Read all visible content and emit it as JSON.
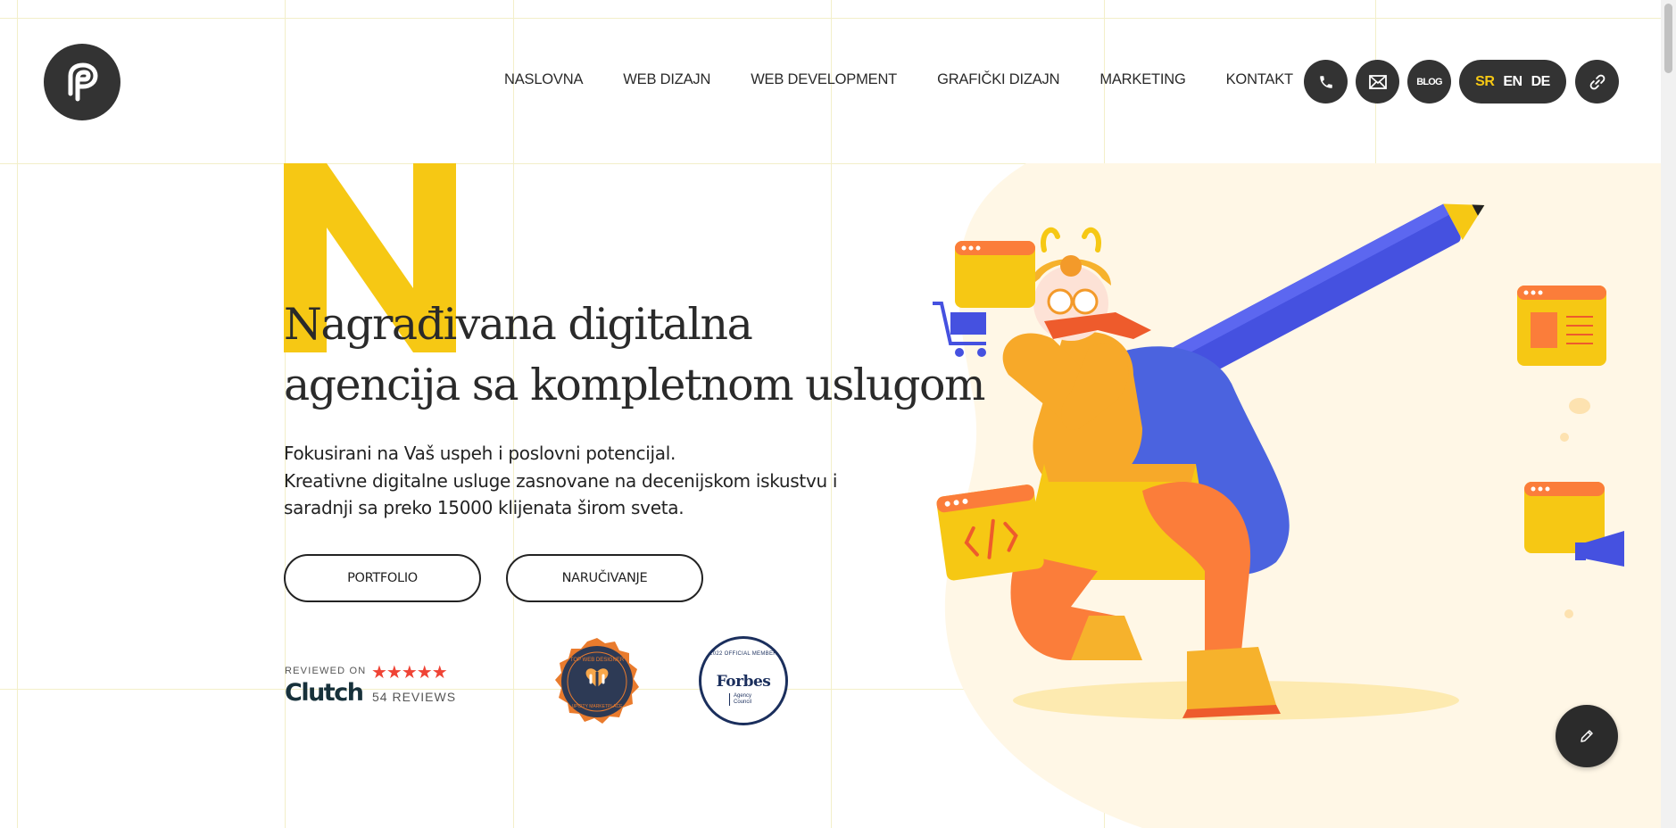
{
  "brand": {
    "logo_icon": "p-swirl-logo"
  },
  "nav": {
    "items": [
      {
        "label": "NASLOVNA"
      },
      {
        "label": "WEB DIZAJN"
      },
      {
        "label": "WEB DEVELOPMENT"
      },
      {
        "label": "GRAFIČKI DIZAJN"
      },
      {
        "label": "MARKETING"
      },
      {
        "label": "KONTAKT"
      }
    ]
  },
  "header_actions": {
    "phone_icon": "phone-icon",
    "mail_icon": "envelope-icon",
    "blog_label": "BLOG",
    "languages": [
      {
        "code": "SR",
        "active": true
      },
      {
        "code": "EN",
        "active": false
      },
      {
        "code": "DE",
        "active": false
      }
    ],
    "link_icon": "link-icon"
  },
  "hero": {
    "decor_letter": "N",
    "headline_line1": "Nagrađivana digitalna",
    "headline_line2": "agencija sa kompletnom uslugom",
    "sub_line1": "Fokusirani na Vaš uspeh i poslovni potencijal.",
    "sub_line2": "Kreativne digitalne usluge zasnovane na decenijskom iskustvu i",
    "sub_line3": "saradnji sa preko 15000 klijenata širom sveta.",
    "btn_portfolio": "PORTFOLIO",
    "btn_order": "NARUČIVANJE"
  },
  "badges": {
    "clutch_reviewed": "REVIEWED ON",
    "clutch_name": "Clutch",
    "clutch_stars": "★★★★★",
    "clutch_reviews": "54 REVIEWS",
    "upcity_top": "TOP WEB DESIGNER",
    "upcity_bottom": "UPCITY MARKETPLACE",
    "forbes_member": "2022 OFFICIAL MEMBER",
    "forbes_name": "Forbes",
    "forbes_sub": "Agency Council"
  },
  "colors": {
    "accent_yellow": "#f6c814",
    "dark": "#333333",
    "hero_bg": "#fff7e6"
  },
  "fab": {
    "icon": "pencil-icon"
  }
}
